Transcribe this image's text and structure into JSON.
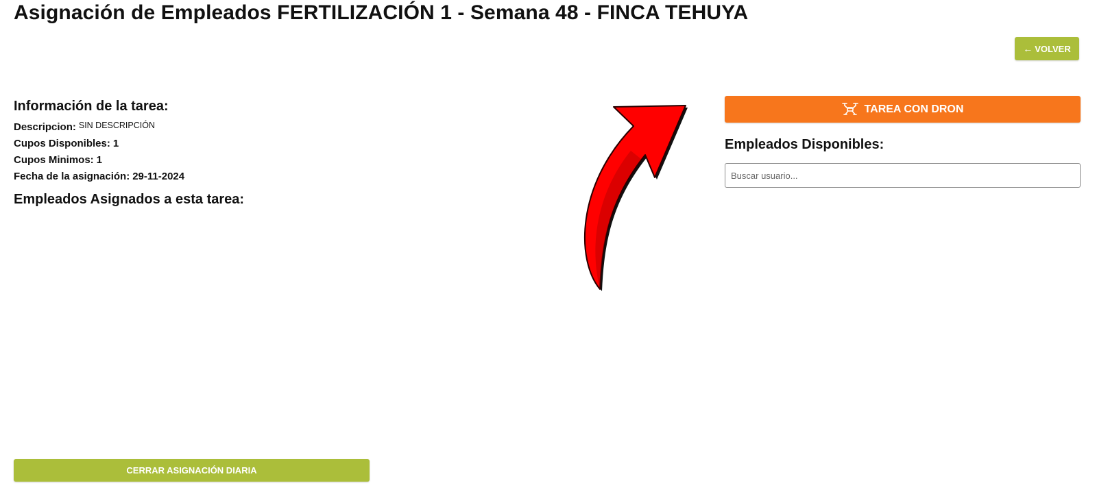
{
  "page": {
    "title": "Asignación de Empleados FERTILIZACIÓN 1 - Semana 48 - FINCA TEHUYA"
  },
  "header": {
    "back_label": "VOLVER",
    "back_icon": "arrow-left-icon"
  },
  "task_info": {
    "heading": "Información de la tarea:",
    "fields": [
      {
        "label": "Descripcion:",
        "value": "SIN DESCRIPCIÓN"
      },
      {
        "label": "Cupos Disponibles:",
        "value": "1"
      },
      {
        "label": "Cupos Minimos:",
        "value": "1"
      },
      {
        "label": "Fecha de la asignación:",
        "value": "29-11-2024"
      }
    ]
  },
  "assigned": {
    "heading": "Empleados Asignados a esta tarea:"
  },
  "footer": {
    "close_label": "CERRAR ASIGNACIÓN DIARIA"
  },
  "drone": {
    "button_label": "TAREA CON DRON",
    "icon": "drone-icon"
  },
  "available": {
    "heading": "Empleados Disponibles:",
    "search_placeholder": "Buscar usuario...",
    "search_value": ""
  },
  "colors": {
    "accent_green": "#abbe3a",
    "accent_orange": "#f7761c",
    "annotation_red": "#ff0000"
  }
}
